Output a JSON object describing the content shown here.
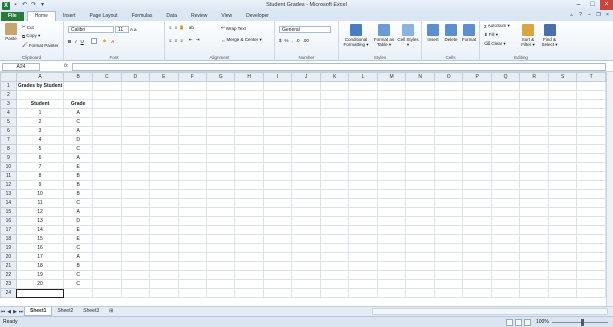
{
  "window": {
    "title": "Student Grades - Microsoft Excel",
    "app_icon": "X"
  },
  "tabs": [
    "File",
    "Home",
    "Insert",
    "Page Layout",
    "Formulas",
    "Data",
    "Review",
    "View",
    "Developer"
  ],
  "ribbon": {
    "clipboard": {
      "label": "Clipboard",
      "paste": "Paste",
      "cut": "Cut",
      "copy": "Copy ▾",
      "format_painter": "Format Painter"
    },
    "font": {
      "label": "Font",
      "font_name": "Calibri",
      "font_size": "11",
      "bold": "B",
      "italic": "I",
      "underline": "U"
    },
    "alignment": {
      "label": "Alignment",
      "wrap_text": "Wrap Text",
      "merge_center": "Merge & Center ▾"
    },
    "number": {
      "label": "Number",
      "format": "General",
      "percent": "%",
      "comma": ","
    },
    "styles": {
      "label": "Styles",
      "conditional": "Conditional Formatting ▾",
      "format_table": "Format as Table ▾",
      "cell_styles": "Cell Styles ▾"
    },
    "cells": {
      "label": "Cells",
      "insert": "Insert",
      "delete": "Delete",
      "format": "Format"
    },
    "editing": {
      "label": "Editing",
      "autosum": "AutoSum ▾",
      "fill": "Fill ▾",
      "clear": "Clear ▾",
      "sort_filter": "Sort & Filter ▾",
      "find_select": "Find & Select ▾"
    }
  },
  "formula_bar": {
    "name_box": "A24",
    "fx": "fx",
    "value": ""
  },
  "columns": [
    "A",
    "B",
    "C",
    "D",
    "E",
    "F",
    "G",
    "H",
    "I",
    "J",
    "K",
    "L",
    "M",
    "N",
    "O",
    "P",
    "Q",
    "R",
    "S",
    "T"
  ],
  "sheet": {
    "title": "Grades by Student",
    "header_student": "Student",
    "header_grade": "Grade",
    "rows": [
      [
        "1",
        "A"
      ],
      [
        "2",
        "C"
      ],
      [
        "3",
        "A"
      ],
      [
        "4",
        "D"
      ],
      [
        "5",
        "C"
      ],
      [
        "6",
        "A"
      ],
      [
        "7",
        "E"
      ],
      [
        "8",
        "B"
      ],
      [
        "9",
        "B"
      ],
      [
        "10",
        "B"
      ],
      [
        "11",
        "C"
      ],
      [
        "12",
        "A"
      ],
      [
        "13",
        "D"
      ],
      [
        "14",
        "E"
      ],
      [
        "15",
        "E"
      ],
      [
        "16",
        "C"
      ],
      [
        "17",
        "A"
      ],
      [
        "18",
        "B"
      ],
      [
        "19",
        "C"
      ],
      [
        "20",
        "C"
      ]
    ],
    "selected_cell": "A24",
    "row_count": 24
  },
  "sheet_tabs": [
    "Sheet1",
    "Sheet2",
    "Sheet3"
  ],
  "status": {
    "text": "Ready",
    "zoom": "100%"
  },
  "accent": {
    "file_tab": "#2a7a3b",
    "ribbon_bg": "#eaf0f8"
  }
}
